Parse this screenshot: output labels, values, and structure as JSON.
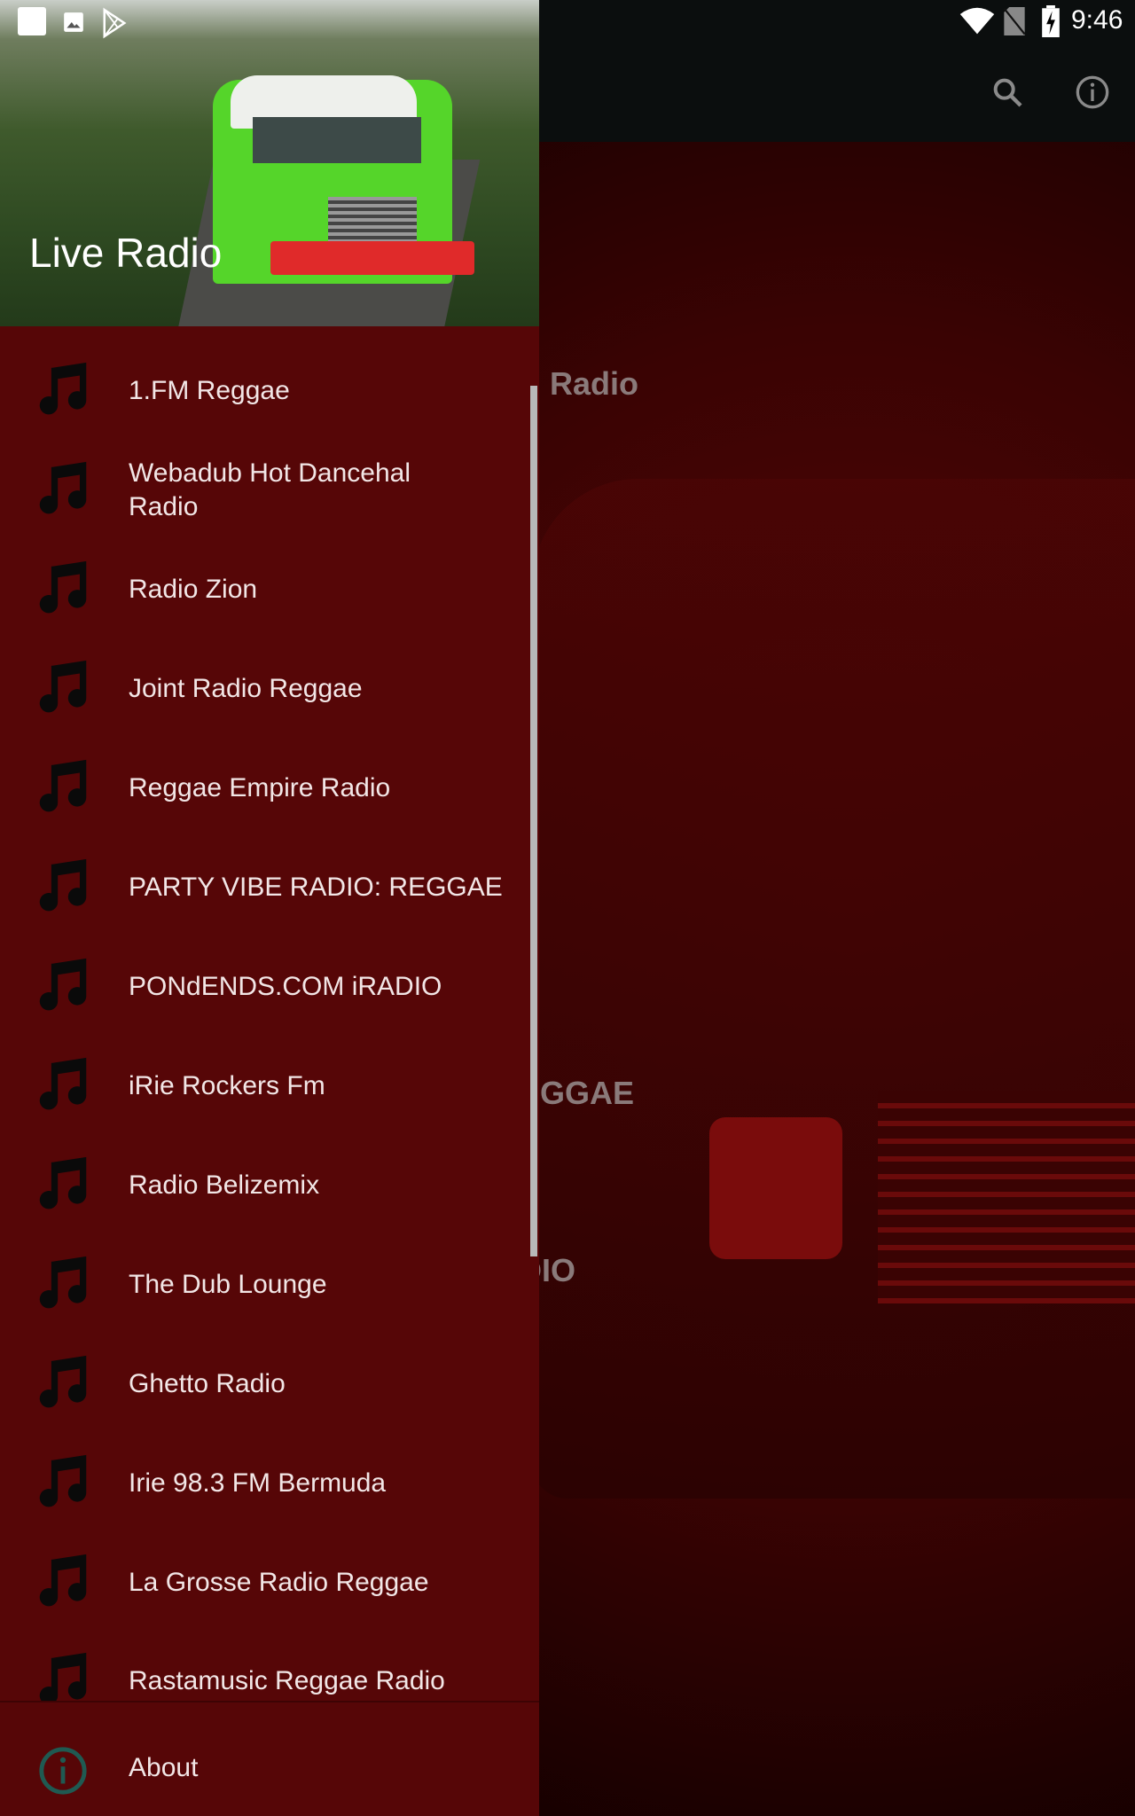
{
  "status_bar": {
    "time": "9:46",
    "icons": [
      "notification-square-icon",
      "image-icon",
      "play-store-icon",
      "wifi-icon",
      "no-sim-icon",
      "battery-charging-icon"
    ]
  },
  "toolbar": {
    "icons": [
      "search-icon",
      "info-icon"
    ]
  },
  "background_fragments": [
    "l Radio",
    "EGGAE",
    "DIO"
  ],
  "drawer": {
    "header_title": "Live Radio",
    "items": [
      {
        "label": "1.FM Reggae"
      },
      {
        "label": "Webadub Hot Dancehal Radio"
      },
      {
        "label": "Radio Zion"
      },
      {
        "label": "Joint Radio Reggae"
      },
      {
        "label": "Reggae Empire Radio"
      },
      {
        "label": "PARTY VIBE RADIO: REGGAE"
      },
      {
        "label": "PONdENDS.COM iRADIO"
      },
      {
        "label": "iRie Rockers Fm"
      },
      {
        "label": "Radio Belizemix"
      },
      {
        "label": "The Dub Lounge"
      },
      {
        "label": "Ghetto Radio"
      },
      {
        "label": "Irie 98.3 FM Bermuda"
      },
      {
        "label": "La Grosse Radio Reggae"
      },
      {
        "label": "Rastamusic Reggae Radio"
      }
    ],
    "about_label": "About",
    "colors": {
      "drawer_bg": "#560607",
      "about_icon": "#1f5a52",
      "text": "#f2e6e6"
    }
  }
}
